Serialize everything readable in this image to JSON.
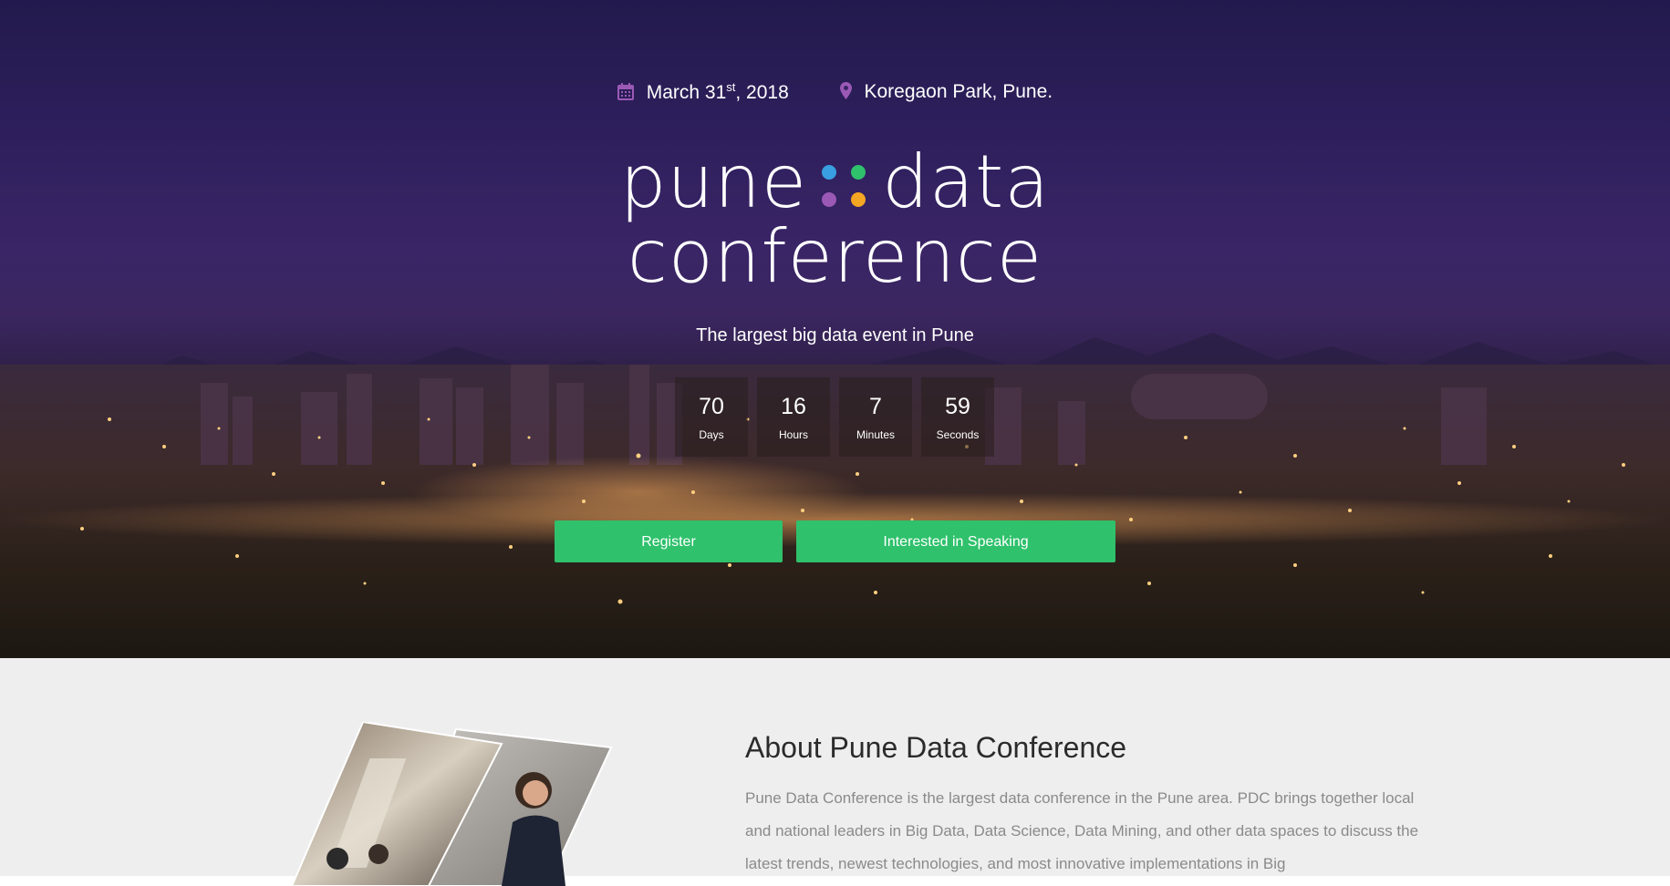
{
  "event": {
    "date_prefix": "March 31",
    "date_suffix": "st",
    "date_year": ", 2018",
    "location": "Koregaon Park, Pune."
  },
  "logo": {
    "word1": "pune",
    "word2": "data",
    "word3": "conference",
    "dot_colors": [
      "#3a9fe0",
      "#2fc16c",
      "#9b59b6",
      "#f5a623"
    ]
  },
  "tagline": "The largest big data event in Pune",
  "countdown": [
    {
      "value": "70",
      "label": "Days"
    },
    {
      "value": "16",
      "label": "Hours"
    },
    {
      "value": "7",
      "label": "Minutes"
    },
    {
      "value": "59",
      "label": "Seconds"
    }
  ],
  "buttons": {
    "register": "Register",
    "speaking": "Interested in Speaking"
  },
  "about": {
    "title": "About Pune Data Conference",
    "text": "Pune Data Conference is the largest data conference in the Pune area. PDC brings together local and national leaders in Big Data, Data Science, Data Mining, and other data spaces to discuss the latest trends, newest technologies, and most innovative implementations in Big"
  },
  "colors": {
    "accent": "#2fc16c",
    "icon": "#9b59b6",
    "hero_bg": "#2e1f5c",
    "about_bg": "#eeeeee"
  },
  "icons": {
    "date": "calendar-icon",
    "location": "map-pin-icon"
  }
}
